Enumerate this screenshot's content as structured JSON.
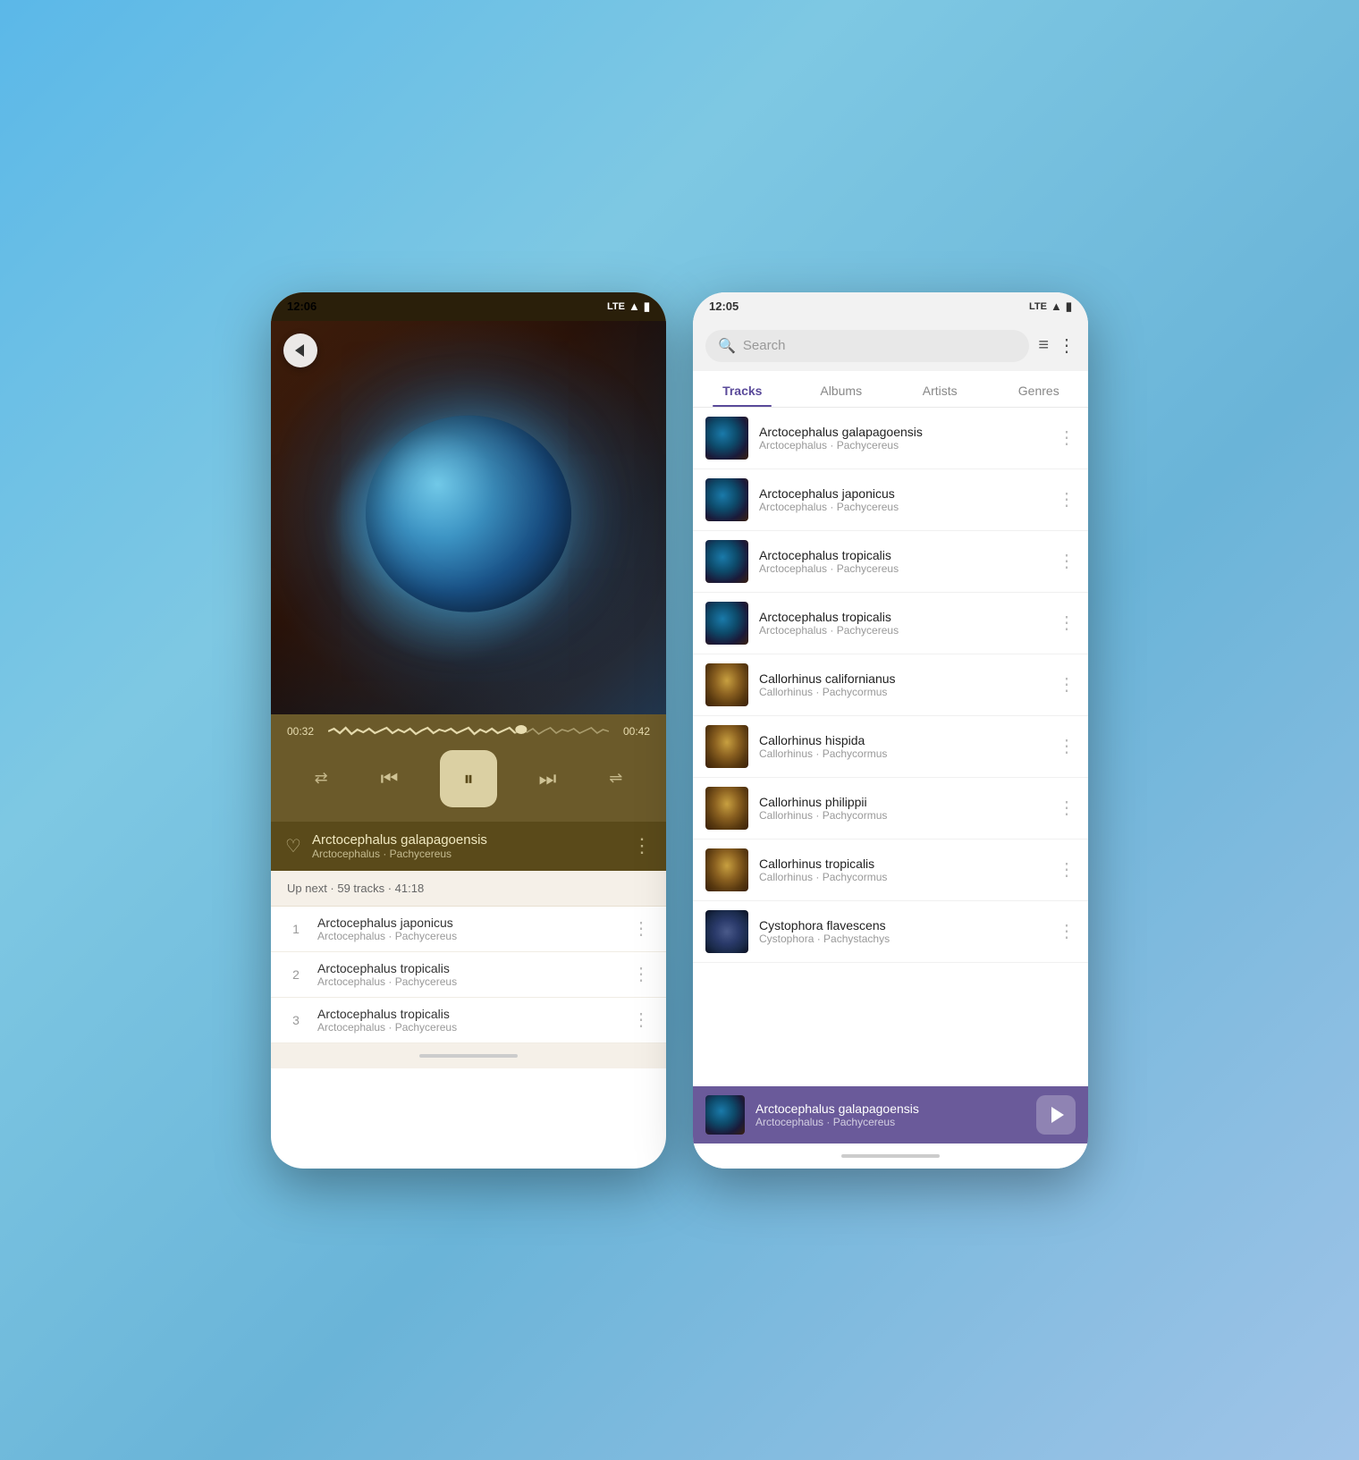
{
  "left_phone": {
    "status": {
      "time": "12:06",
      "signal": "LTE"
    },
    "player": {
      "time_current": "00:32",
      "time_total": "00:42",
      "track_title": "Arctocephalus galapagoensis",
      "track_artist": "Arctocephalus",
      "track_album": "Pachycereus"
    },
    "upnext": {
      "label": "Up next · 59 tracks · 41:18",
      "items": [
        {
          "num": "1",
          "title": "Arctocephalus japonicus",
          "artist": "Arctocephalus",
          "album": "Pachycereus"
        },
        {
          "num": "2",
          "title": "Arctocephalus tropicalis",
          "artist": "Arctocephalus",
          "album": "Pachycereus"
        },
        {
          "num": "3",
          "title": "Arctocephalus tropicalis",
          "artist": "Arctocephalus",
          "album": "Pachycereus"
        }
      ]
    },
    "controls": {
      "repeat": "⇄",
      "prev": "⏮",
      "pause": "⏸",
      "next": "⏭",
      "shuffle": "⇀"
    }
  },
  "right_phone": {
    "status": {
      "time": "12:05",
      "signal": "LTE"
    },
    "search": {
      "placeholder": "Search"
    },
    "tabs": [
      {
        "label": "Tracks",
        "active": true
      },
      {
        "label": "Albums",
        "active": false
      },
      {
        "label": "Artists",
        "active": false
      },
      {
        "label": "Genres",
        "active": false
      }
    ],
    "tracks": [
      {
        "title": "Arctocephalus galapagoensis",
        "artist": "Arctocephalus",
        "album": "Pachycereus",
        "thumb": "nebula"
      },
      {
        "title": "Arctocephalus japonicus",
        "artist": "Arctocephalus",
        "album": "Pachycereus",
        "thumb": "nebula"
      },
      {
        "title": "Arctocephalus tropicalis",
        "artist": "Arctocephalus",
        "album": "Pachycereus",
        "thumb": "nebula"
      },
      {
        "title": "Arctocephalus tropicalis",
        "artist": "Arctocephalus",
        "album": "Pachycereus",
        "thumb": "nebula"
      },
      {
        "title": "Callorhinus californianus",
        "artist": "Callorhinus",
        "album": "Pachycormus",
        "thumb": "golden"
      },
      {
        "title": "Callorhinus hispida",
        "artist": "Callorhinus",
        "album": "Pachycormus",
        "thumb": "golden"
      },
      {
        "title": "Callorhinus philippii",
        "artist": "Callorhinus",
        "album": "Pachycormus",
        "thumb": "golden"
      },
      {
        "title": "Callorhinus tropicalis",
        "artist": "Callorhinus",
        "album": "Pachycormus",
        "thumb": "golden"
      },
      {
        "title": "Cystophora flavescens",
        "artist": "Cystophora",
        "album": "Pachystachys",
        "thumb": "space"
      }
    ],
    "mini_player": {
      "title": "Arctocephalus galapagoensis",
      "artist": "Arctocephalus",
      "album": "Pachycereus"
    }
  },
  "icons": {
    "back": "←",
    "heart": "♡",
    "more_vert": "⋮",
    "sort": "≡",
    "search_sym": "🔍",
    "repeat": "↻",
    "shuffle": "⇌",
    "lte": "LTE",
    "signal": "📶",
    "battery": "🔋"
  }
}
